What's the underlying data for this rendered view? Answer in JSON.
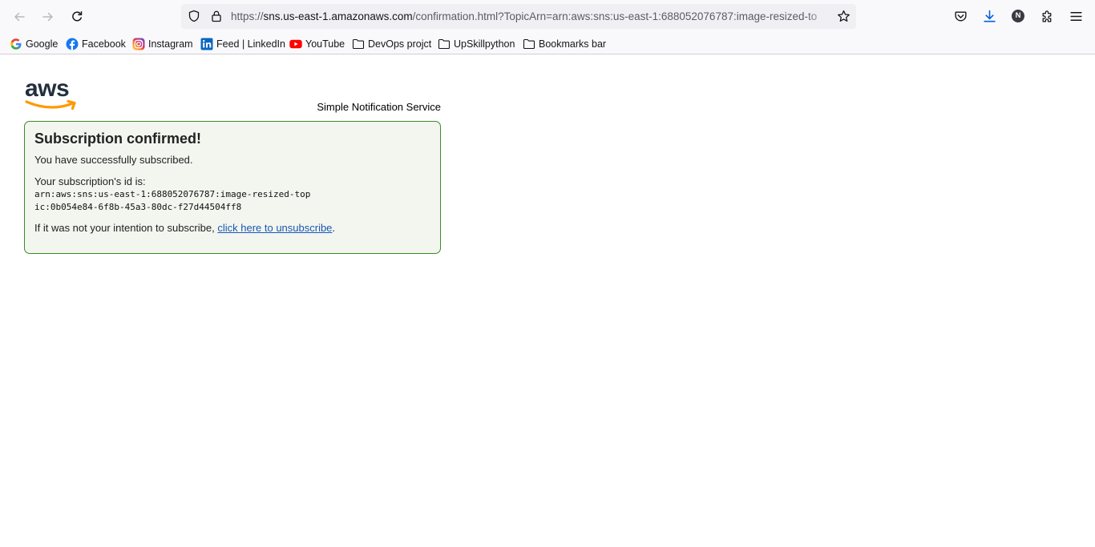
{
  "browser": {
    "url_scheme": "https://",
    "url_host": "sns.us-east-1.amazonaws.com",
    "url_path": "/confirmation.html?TopicArn=arn:aws:sns:us-east-1:688052076787:image-resized-to",
    "profile_initial": "N",
    "icons": {
      "back": "arrow-left-icon",
      "forward": "arrow-right-icon",
      "reload": "reload-icon",
      "tracking": "shield-icon",
      "secure": "lock-icon",
      "bookmark": "star-icon",
      "pocket": "pocket-icon",
      "downloads": "download-icon",
      "extensions": "puzzle-icon",
      "menu": "hamburger-icon"
    }
  },
  "bookmarks": [
    {
      "label": "Google",
      "icon": "google-icon"
    },
    {
      "label": "Facebook",
      "icon": "facebook-icon"
    },
    {
      "label": "Instagram",
      "icon": "instagram-icon"
    },
    {
      "label": "Feed | LinkedIn",
      "icon": "linkedin-icon"
    },
    {
      "label": "YouTube",
      "icon": "youtube-icon"
    },
    {
      "label": "DevOps projct",
      "icon": "folder-icon"
    },
    {
      "label": "UpSkillpython",
      "icon": "folder-icon"
    },
    {
      "label": "Bookmarks bar",
      "icon": "folder-icon"
    }
  ],
  "page": {
    "logo_text": "aws",
    "service_name": "Simple Notification Service",
    "heading": "Subscription confirmed!",
    "success_message": "You have successfully subscribed.",
    "id_label": "Your subscription's id is:",
    "subscription_id": "arn:aws:sns:us-east-1:688052076787:image-resized-topic:0b054e84-6f8b-45a3-80dc-f27d44504ff8",
    "unsubscribe_prefix": "If it was not your intention to subscribe, ",
    "unsubscribe_link": "click here to unsubscribe",
    "unsubscribe_suffix": "."
  },
  "colors": {
    "box_border": "#3b8b27",
    "box_background": "#f2f6ef",
    "link": "#1a56b4",
    "aws_orange": "#ff9900",
    "aws_navy": "#232f3e"
  }
}
